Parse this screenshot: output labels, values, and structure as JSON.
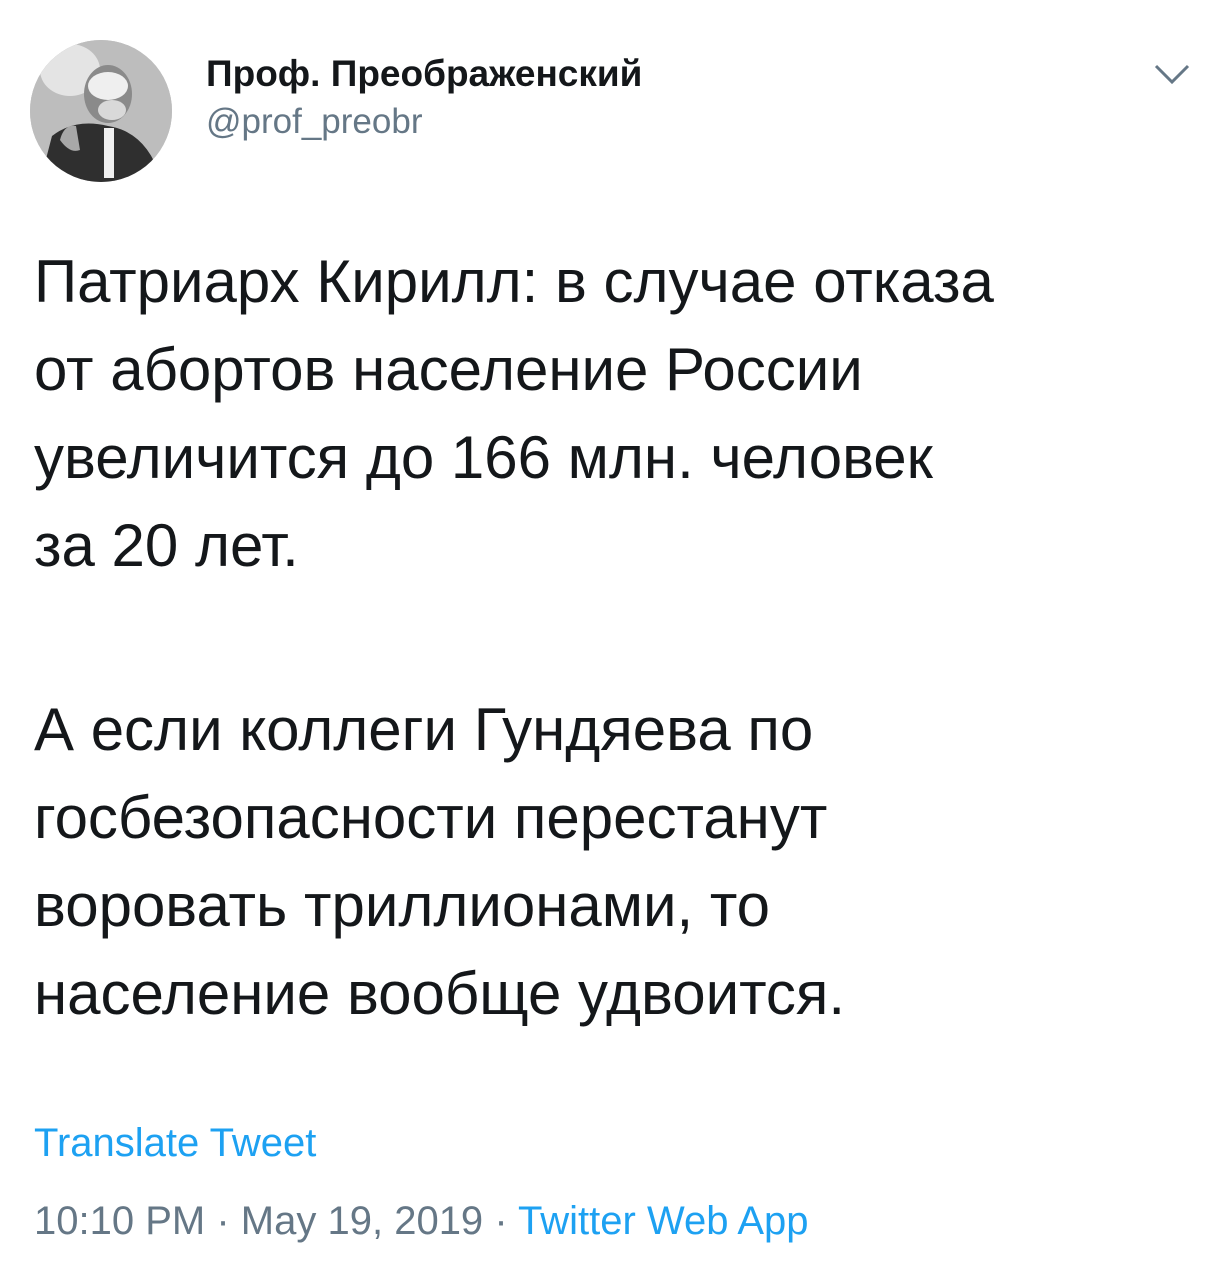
{
  "author": {
    "display_name": "Проф. Преображенский",
    "handle": "@prof_preobr",
    "avatar_icon": "avatar-photo"
  },
  "tweet": {
    "paragraph_1": "Патриарх Кирилл: в случае отказа\nот абортов население России\nувеличится до 166 млн. человек\nза 20 лет.",
    "paragraph_2": "А если коллеги Гундяева по\nгосбезопасности перестанут\nворовать триллионами, то\nнаселение вообще удвоится.",
    "translate_label": "Translate Tweet",
    "time": "10:10 PM",
    "separator": "·",
    "date": "May 19, 2019",
    "source": "Twitter Web App"
  },
  "colors": {
    "text": "#14171a",
    "secondary": "#657786",
    "link": "#1da1f2"
  }
}
